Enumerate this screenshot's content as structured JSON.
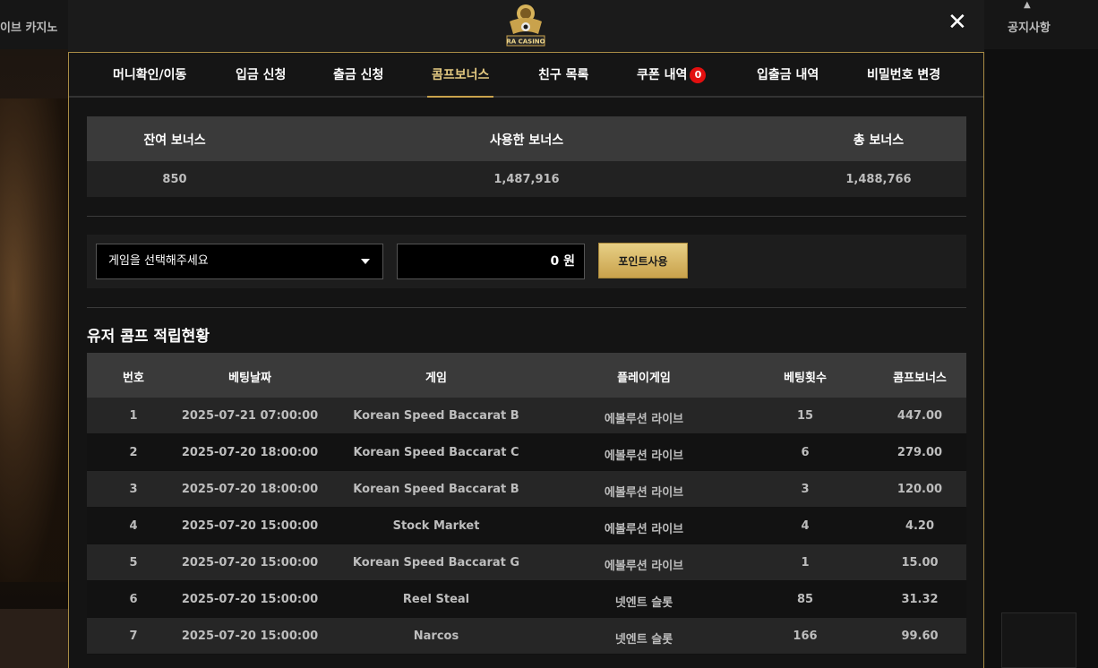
{
  "background": {
    "left_label": "이브 카지노",
    "right_label": "공지사항"
  },
  "header": {
    "logo_text": "RA CASINO",
    "close_symbol": "✕"
  },
  "tabs": [
    {
      "label": "머니확인/이동"
    },
    {
      "label": "입금 신청"
    },
    {
      "label": "출금 신청"
    },
    {
      "label": "콤프보너스",
      "active": true
    },
    {
      "label": "친구 목록"
    },
    {
      "label": "쿠폰 내역",
      "badge": "0"
    },
    {
      "label": "입출금 내역"
    },
    {
      "label": "비밀번호 변경"
    }
  ],
  "summary": {
    "headers": [
      "잔여 보너스",
      "사용한 보너스",
      "총 보너스"
    ],
    "values": [
      "850",
      "1,487,916",
      "1,488,766"
    ]
  },
  "controls": {
    "select_value": "게임을 선택해주세요",
    "points_value": "0 원",
    "use_button": "포인트사용"
  },
  "section_title": "유저 콤프 적립현황",
  "table": {
    "headers": [
      "번호",
      "베팅날짜",
      "게임",
      "플레이게임",
      "베팅횟수",
      "콤프보너스"
    ],
    "rows": [
      [
        "1",
        "2025-07-21 07:00:00",
        "Korean Speed Baccarat B",
        "에볼루션 라이브",
        "15",
        "447.00"
      ],
      [
        "2",
        "2025-07-20 18:00:00",
        "Korean Speed Baccarat C",
        "에볼루션 라이브",
        "6",
        "279.00"
      ],
      [
        "3",
        "2025-07-20 18:00:00",
        "Korean Speed Baccarat B",
        "에볼루션 라이브",
        "3",
        "120.00"
      ],
      [
        "4",
        "2025-07-20 15:00:00",
        "Stock Market",
        "에볼루션 라이브",
        "4",
        "4.20"
      ],
      [
        "5",
        "2025-07-20 15:00:00",
        "Korean Speed Baccarat G",
        "에볼루션 라이브",
        "1",
        "15.00"
      ],
      [
        "6",
        "2025-07-20 15:00:00",
        "Reel Steal",
        "넷엔트 슬롯",
        "85",
        "31.32"
      ],
      [
        "7",
        "2025-07-20 15:00:00",
        "Narcos",
        "넷엔트 슬롯",
        "166",
        "99.60"
      ]
    ]
  },
  "colors": {
    "accent_gold": "#c9a24c",
    "active_tab": "#e2c880",
    "badge_red": "#e20f0f"
  }
}
